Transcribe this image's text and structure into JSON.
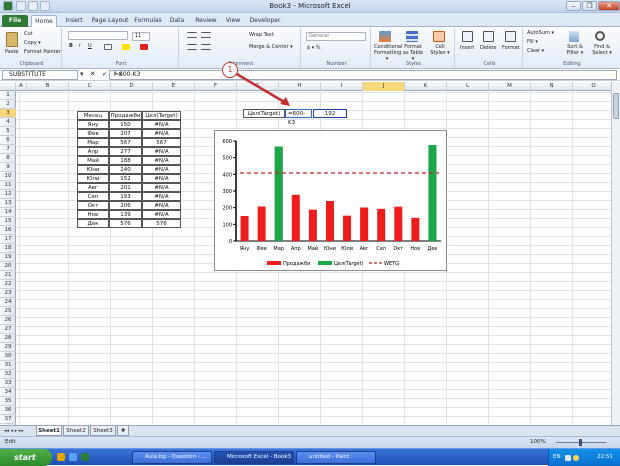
{
  "window": {
    "title": "Book3 - Microsoft Excel",
    "minimize": "–",
    "maximize": "❐",
    "close": "✕"
  },
  "tabs": [
    {
      "label": "File",
      "kind": "file"
    },
    {
      "label": "Home",
      "kind": "active"
    },
    {
      "label": "Insert"
    },
    {
      "label": "Page Layout"
    },
    {
      "label": "Formulas"
    },
    {
      "label": "Data"
    },
    {
      "label": "Review"
    },
    {
      "label": "View"
    },
    {
      "label": "Developer"
    }
  ],
  "ribbon": {
    "clipboard": {
      "paste": "Paste",
      "cut": "Cut",
      "copy": "Copy ▾",
      "format_painter": "Format Painter",
      "label": "Clipboard"
    },
    "font": {
      "size": "11",
      "bold": "B",
      "italic": "I",
      "underline": "U",
      "label": "Font"
    },
    "alignment": {
      "wrap": "Wrap Text",
      "merge": "Merge & Center ▾",
      "label": "Alignment"
    },
    "number": {
      "format": "General",
      "currency": "$ ▾ %",
      "label": "Number"
    },
    "styles": {
      "conditional": "Conditional Formatting ▾",
      "as_table": "Format as Table ▾",
      "cell_styles": "Cell Styles ▾",
      "label": "Styles"
    },
    "cells": {
      "insert": "Insert",
      "delete": "Delete",
      "format": "Format",
      "label": "Cells"
    },
    "editing": {
      "autosum": "AutoSum ▾",
      "fill": "Fill ▾",
      "clear": "Clear ▾",
      "sort": "Sort & Filter ▾",
      "find": "Find & Select ▾",
      "label": "Editing"
    }
  },
  "formula_bar": {
    "name_box": "SUBSTITUTE",
    "icons": "▾ ✕ ✓ fx",
    "formula": "=600-K3"
  },
  "columns": [
    {
      "label": "A",
      "sel": false
    },
    {
      "label": "B",
      "sel": false
    },
    {
      "label": "C",
      "sel": false
    },
    {
      "label": "D",
      "sel": false
    },
    {
      "label": "E",
      "sel": false
    },
    {
      "label": "F",
      "sel": false
    },
    {
      "label": "G",
      "sel": false
    },
    {
      "label": "H",
      "sel": false
    },
    {
      "label": "I",
      "sel": false
    },
    {
      "label": "J",
      "sel": true
    },
    {
      "label": "K",
      "sel": false
    },
    {
      "label": "L",
      "sel": false
    },
    {
      "label": "M",
      "sel": false
    },
    {
      "label": "N",
      "sel": false
    },
    {
      "label": "O",
      "sel": false
    }
  ],
  "rows": [
    "1",
    "2",
    "3",
    "4",
    "5",
    "6",
    "7",
    "8",
    "9",
    "10",
    "11",
    "12",
    "13",
    "14",
    "15",
    "16",
    "17",
    "18",
    "19",
    "20",
    "21",
    "22",
    "23",
    "24",
    "25",
    "26",
    "27",
    "28",
    "29",
    "30",
    "31",
    "32",
    "33",
    "34",
    "35",
    "36",
    "37"
  ],
  "selected_row": "3",
  "table": {
    "headers": [
      "Месец",
      "Продажби",
      "Цел(Target)"
    ],
    "rows": [
      [
        "Яну",
        "150",
        "#N/A"
      ],
      [
        "Фев",
        "207",
        "#N/A"
      ],
      [
        "Мар",
        "567",
        "567"
      ],
      [
        "Апр",
        "277",
        "#N/A"
      ],
      [
        "Май",
        "188",
        "#N/A"
      ],
      [
        "Юни",
        "240",
        "#N/A"
      ],
      [
        "Юли",
        "152",
        "#N/A"
      ],
      [
        "Авг",
        "201",
        "#N/A"
      ],
      [
        "Сеп",
        "193",
        "#N/A"
      ],
      [
        "Окт",
        "206",
        "#N/A"
      ],
      [
        "Ное",
        "139",
        "#N/A"
      ],
      [
        "Дек",
        "576",
        "576"
      ]
    ]
  },
  "target_block": {
    "label": "Цел(Target)",
    "formula": "=600-K3",
    "value": "192"
  },
  "annotation": {
    "number": "1"
  },
  "chart_data": {
    "type": "bar",
    "categories": [
      "Яну",
      "Фев",
      "Мар",
      "Апр",
      "Май",
      "Юни",
      "Юли",
      "Авг",
      "Сеп",
      "Окт",
      "Ное",
      "Дек"
    ],
    "series": [
      {
        "name": "Продажби",
        "color": "#ee1c1c",
        "values": [
          150,
          207,
          567,
          277,
          188,
          240,
          152,
          201,
          193,
          206,
          139,
          576
        ]
      },
      {
        "name": "Цел(Target)",
        "color": "#19a84a",
        "values": [
          null,
          null,
          567,
          null,
          null,
          null,
          null,
          null,
          null,
          null,
          null,
          576
        ]
      }
    ],
    "line": {
      "name": "WETG",
      "color": "#c02020",
      "value": 408
    },
    "ylim": [
      0,
      600
    ],
    "yticks": [
      "0",
      "100",
      "200",
      "300",
      "400",
      "500",
      "600"
    ],
    "title": "",
    "xlabel": "",
    "ylabel": "",
    "legend": "bottom",
    "grid": false
  },
  "sheets": [
    {
      "label": "Sheet1",
      "active": true
    },
    {
      "label": "Sheet2",
      "active": false
    },
    {
      "label": "Sheet3",
      "active": false
    }
  ],
  "status": {
    "mode": "Edit",
    "zoom": "100%"
  },
  "taskbar": {
    "start": "start",
    "tasks": [
      {
        "label": "Aula.bg - Question - ...",
        "active": false
      },
      {
        "label": "Microsoft Excel - Book3",
        "active": true
      },
      {
        "label": "untitled - Paint",
        "active": false
      }
    ],
    "tray": {
      "lang": "EN",
      "clock": "22:51"
    }
  }
}
